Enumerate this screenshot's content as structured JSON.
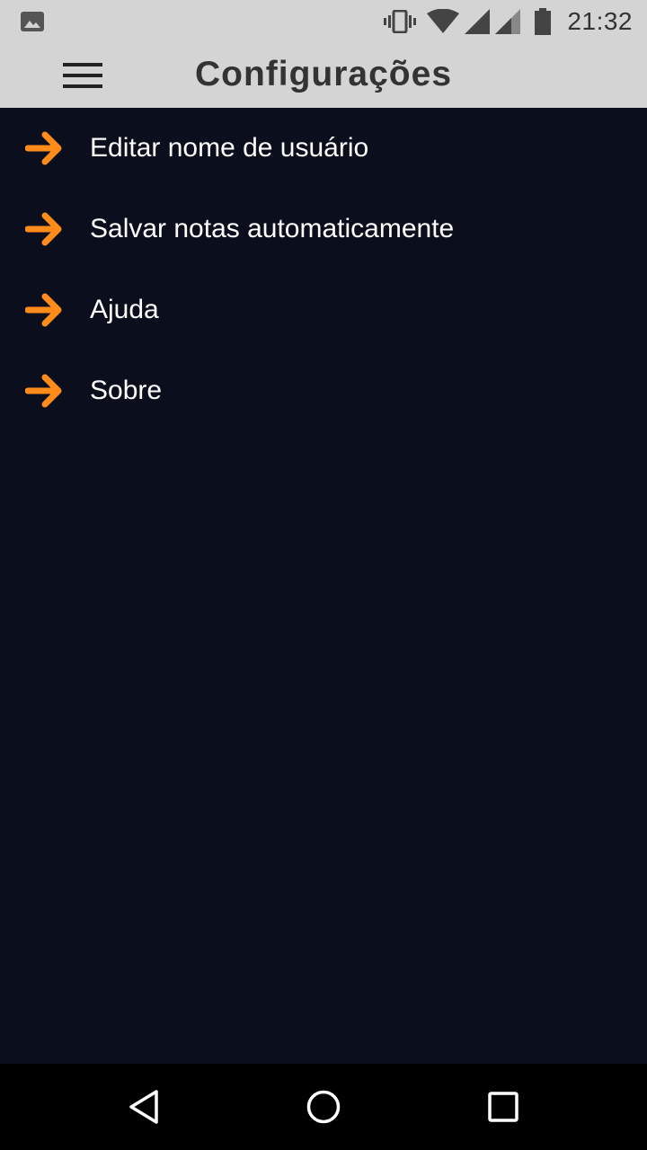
{
  "status_bar": {
    "time": "21:32",
    "icons": [
      "gallery-icon",
      "vibrate-icon",
      "wifi-icon",
      "signal-icon",
      "signal-icon",
      "battery-icon"
    ]
  },
  "app_bar": {
    "title": "Configurações",
    "menu_icon": "hamburger-menu-icon"
  },
  "settings": {
    "items": [
      {
        "label": "Editar nome de usuário",
        "icon": "arrow-right-icon"
      },
      {
        "label": "Salvar notas automaticamente",
        "icon": "arrow-right-icon"
      },
      {
        "label": "Ajuda",
        "icon": "arrow-right-icon"
      },
      {
        "label": "Sobre",
        "icon": "arrow-right-icon"
      }
    ]
  },
  "nav_bar": {
    "buttons": [
      "back-icon",
      "home-icon",
      "recents-icon"
    ]
  },
  "colors": {
    "background": "#0b0e1c",
    "app_bar": "#d4d4d4",
    "accent": "#ff8c1a",
    "text_light": "#ffffff",
    "text_dark": "#333333"
  }
}
